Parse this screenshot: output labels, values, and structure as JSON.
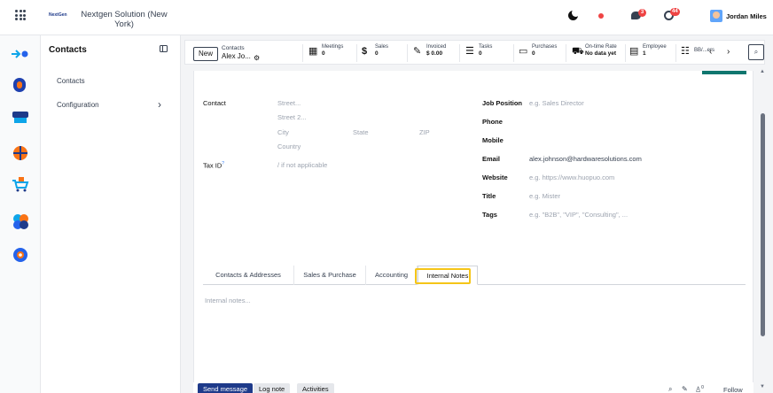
{
  "header": {
    "company_logo_text": "NextGen",
    "company_name": "Nextgen Solution (New York)",
    "chat_badge": "3",
    "activity_badge": "44",
    "user_name": "Jordan Miles"
  },
  "rail": {
    "icons": [
      "transfer-icon",
      "contacts-app-icon",
      "shop-icon",
      "globe-icon",
      "cart-icon",
      "puzzle-icon",
      "settings-app-icon"
    ],
    "colors": [
      "#0ea5e9",
      "#2563eb",
      "#1e3a8a",
      "#f97316",
      "#0ea5e9",
      "#f97316",
      "#2563eb"
    ]
  },
  "leftnav": {
    "title": "Contacts",
    "items": [
      {
        "label": "Contacts"
      },
      {
        "label": "Configuration"
      }
    ]
  },
  "controlbar": {
    "new_label": "New",
    "breadcrumb_app": "Contacts",
    "breadcrumb_record": "Alex Jo...",
    "smart_buttons": [
      {
        "icon": "calendar-icon",
        "label": "Meetings",
        "value": "0"
      },
      {
        "icon": "dollar-icon",
        "label": "Sales",
        "value": "0"
      },
      {
        "icon": "pencil-icon",
        "label": "Invoiced",
        "value": "$ 0.00"
      },
      {
        "icon": "tasks-icon",
        "label": "Tasks",
        "value": "0"
      },
      {
        "icon": "card-icon",
        "label": "Purchases",
        "value": "0"
      },
      {
        "icon": "truck-icon",
        "label": "On-time Rate",
        "value": "No data yet"
      },
      {
        "icon": "id-card-icon",
        "label": "Employee",
        "value": "1"
      },
      {
        "icon": "list-icon",
        "label": "BB/...ers",
        "value": ""
      }
    ],
    "pager_prev": "‹",
    "pager_next": "›"
  },
  "form": {
    "contact_label": "Contact",
    "street_placeholder": "Street...",
    "street2_placeholder": "Street 2...",
    "city_placeholder": "City",
    "state_placeholder": "State",
    "zip_placeholder": "ZIP",
    "country_placeholder": "Country",
    "tax_id_label": "Tax ID",
    "tax_id_tooltip": "?",
    "tax_id_placeholder": "/ if not applicable",
    "job_position_label": "Job Position",
    "job_position_placeholder": "e.g. Sales Director",
    "phone_label": "Phone",
    "mobile_label": "Mobile",
    "email_label": "Email",
    "email_value": "alex.johnson@hardwaresolutions.com",
    "website_label": "Website",
    "website_placeholder": "e.g. https://www.huopuo.com",
    "title_label": "Title",
    "title_placeholder": "e.g. Mister",
    "tags_label": "Tags",
    "tags_placeholder": "e.g. \"B2B\", \"VIP\", \"Consulting\", ..."
  },
  "tabs": [
    {
      "label": "Contacts & Addresses"
    },
    {
      "label": "Sales & Purchase"
    },
    {
      "label": "Accounting"
    },
    {
      "label": "Internal Notes",
      "active": true
    }
  ],
  "notes_placeholder": "Internal notes...",
  "chatter": {
    "send_message": "Send message",
    "log_note": "Log note",
    "activities": "Activities",
    "followers_count": "0",
    "follow_label": "Follow"
  }
}
